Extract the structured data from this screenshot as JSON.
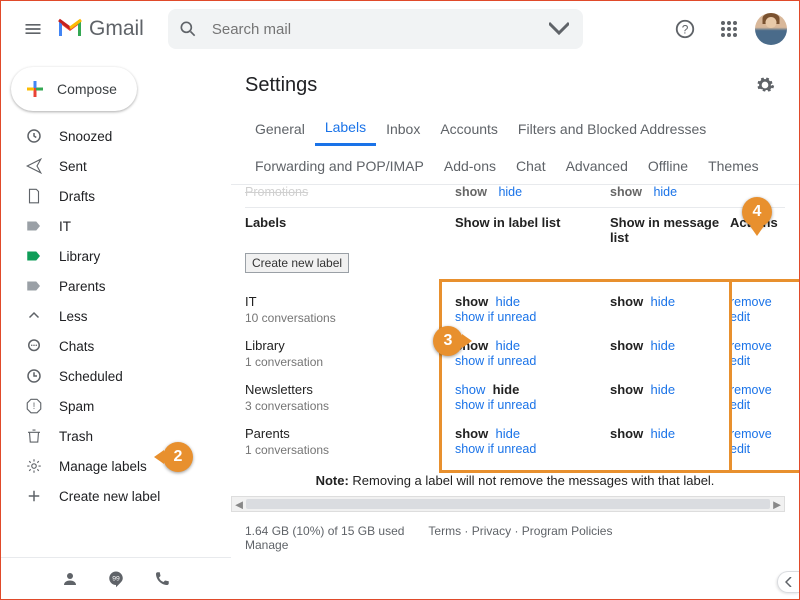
{
  "header": {
    "brand": "Gmail",
    "search_placeholder": "Search mail"
  },
  "compose": {
    "label": "Compose"
  },
  "sidebar": {
    "items": [
      {
        "icon": "snooze",
        "label": "Snoozed"
      },
      {
        "icon": "send",
        "label": "Sent"
      },
      {
        "icon": "drafts",
        "label": "Drafts"
      },
      {
        "icon": "label",
        "label": "IT"
      },
      {
        "icon": "label",
        "label": "Library",
        "selected": true
      },
      {
        "icon": "label",
        "label": "Parents"
      },
      {
        "icon": "less",
        "label": "Less"
      },
      {
        "icon": "chats",
        "label": "Chats"
      },
      {
        "icon": "scheduled",
        "label": "Scheduled"
      },
      {
        "icon": "spam",
        "label": "Spam"
      },
      {
        "icon": "trash",
        "label": "Trash"
      },
      {
        "icon": "gear",
        "label": "Manage labels"
      },
      {
        "icon": "plus",
        "label": "Create new label"
      }
    ]
  },
  "settings": {
    "title": "Settings",
    "tabs_row1": [
      "General",
      "Labels",
      "Inbox",
      "Accounts",
      "Filters and Blocked Addresses"
    ],
    "tabs_row2": [
      "Forwarding and POP/IMAP",
      "Add-ons",
      "Chat",
      "Advanced",
      "Offline",
      "Themes"
    ],
    "active_tab": "Labels"
  },
  "table": {
    "promo": {
      "name": "Promotions",
      "col2": {
        "show": "show",
        "hide": "hide"
      },
      "col3": {
        "show": "show",
        "hide": "hide"
      }
    },
    "section_label": "Labels",
    "head_col2": "Show in label list",
    "head_col3": "Show in message list",
    "head_col4": "Actions",
    "create_btn": "Create new label",
    "rows": [
      {
        "name": "IT",
        "sub": "10 conversations",
        "c2": {
          "show": "show",
          "hide": "hide",
          "unread": "show if unread",
          "show_bold": true
        },
        "c3": {
          "show": "show",
          "hide": "hide",
          "show_bold": true
        },
        "actions": {
          "remove": "remove",
          "edit": "edit"
        }
      },
      {
        "name": "Library",
        "sub": "1 conversation",
        "c2": {
          "show": "show",
          "hide": "hide",
          "unread": "show if unread",
          "show_bold": true
        },
        "c3": {
          "show": "show",
          "hide": "hide",
          "show_bold": true
        },
        "actions": {
          "remove": "remove",
          "edit": "edit"
        }
      },
      {
        "name": "Newsletters",
        "sub": "3 conversations",
        "c2": {
          "show": "show",
          "hide": "hide",
          "unread": "show if unread",
          "hide_bold": true
        },
        "c3": {
          "show": "show",
          "hide": "hide",
          "show_bold": true
        },
        "actions": {
          "remove": "remove",
          "edit": "edit"
        }
      },
      {
        "name": "Parents",
        "sub": "1 conversations",
        "c2": {
          "show": "show",
          "hide": "hide",
          "unread": "show if unread",
          "show_bold": true
        },
        "c3": {
          "show": "show",
          "hide": "hide",
          "show_bold": true
        },
        "actions": {
          "remove": "remove",
          "edit": "edit"
        }
      }
    ],
    "note_bold": "Note:",
    "note_text": " Removing a label will not remove the messages with that label."
  },
  "footer": {
    "storage": "1.64 GB (10%) of 15 GB used",
    "manage": "Manage",
    "links": [
      "Terms",
      "Privacy",
      "Program Policies"
    ]
  },
  "callouts": {
    "c2": "2",
    "c3": "3",
    "c4": "4"
  }
}
